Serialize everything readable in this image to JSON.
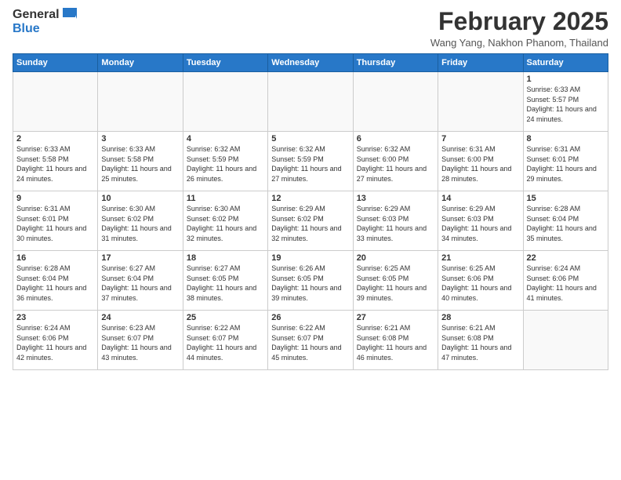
{
  "header": {
    "logo_general": "General",
    "logo_blue": "Blue",
    "month_title": "February 2025",
    "location": "Wang Yang, Nakhon Phanom, Thailand"
  },
  "weekdays": [
    "Sunday",
    "Monday",
    "Tuesday",
    "Wednesday",
    "Thursday",
    "Friday",
    "Saturday"
  ],
  "weeks": [
    [
      {
        "day": "",
        "info": ""
      },
      {
        "day": "",
        "info": ""
      },
      {
        "day": "",
        "info": ""
      },
      {
        "day": "",
        "info": ""
      },
      {
        "day": "",
        "info": ""
      },
      {
        "day": "",
        "info": ""
      },
      {
        "day": "1",
        "info": "Sunrise: 6:33 AM\nSunset: 5:57 PM\nDaylight: 11 hours and 24 minutes."
      }
    ],
    [
      {
        "day": "2",
        "info": "Sunrise: 6:33 AM\nSunset: 5:58 PM\nDaylight: 11 hours and 24 minutes."
      },
      {
        "day": "3",
        "info": "Sunrise: 6:33 AM\nSunset: 5:58 PM\nDaylight: 11 hours and 25 minutes."
      },
      {
        "day": "4",
        "info": "Sunrise: 6:32 AM\nSunset: 5:59 PM\nDaylight: 11 hours and 26 minutes."
      },
      {
        "day": "5",
        "info": "Sunrise: 6:32 AM\nSunset: 5:59 PM\nDaylight: 11 hours and 27 minutes."
      },
      {
        "day": "6",
        "info": "Sunrise: 6:32 AM\nSunset: 6:00 PM\nDaylight: 11 hours and 27 minutes."
      },
      {
        "day": "7",
        "info": "Sunrise: 6:31 AM\nSunset: 6:00 PM\nDaylight: 11 hours and 28 minutes."
      },
      {
        "day": "8",
        "info": "Sunrise: 6:31 AM\nSunset: 6:01 PM\nDaylight: 11 hours and 29 minutes."
      }
    ],
    [
      {
        "day": "9",
        "info": "Sunrise: 6:31 AM\nSunset: 6:01 PM\nDaylight: 11 hours and 30 minutes."
      },
      {
        "day": "10",
        "info": "Sunrise: 6:30 AM\nSunset: 6:02 PM\nDaylight: 11 hours and 31 minutes."
      },
      {
        "day": "11",
        "info": "Sunrise: 6:30 AM\nSunset: 6:02 PM\nDaylight: 11 hours and 32 minutes."
      },
      {
        "day": "12",
        "info": "Sunrise: 6:29 AM\nSunset: 6:02 PM\nDaylight: 11 hours and 32 minutes."
      },
      {
        "day": "13",
        "info": "Sunrise: 6:29 AM\nSunset: 6:03 PM\nDaylight: 11 hours and 33 minutes."
      },
      {
        "day": "14",
        "info": "Sunrise: 6:29 AM\nSunset: 6:03 PM\nDaylight: 11 hours and 34 minutes."
      },
      {
        "day": "15",
        "info": "Sunrise: 6:28 AM\nSunset: 6:04 PM\nDaylight: 11 hours and 35 minutes."
      }
    ],
    [
      {
        "day": "16",
        "info": "Sunrise: 6:28 AM\nSunset: 6:04 PM\nDaylight: 11 hours and 36 minutes."
      },
      {
        "day": "17",
        "info": "Sunrise: 6:27 AM\nSunset: 6:04 PM\nDaylight: 11 hours and 37 minutes."
      },
      {
        "day": "18",
        "info": "Sunrise: 6:27 AM\nSunset: 6:05 PM\nDaylight: 11 hours and 38 minutes."
      },
      {
        "day": "19",
        "info": "Sunrise: 6:26 AM\nSunset: 6:05 PM\nDaylight: 11 hours and 39 minutes."
      },
      {
        "day": "20",
        "info": "Sunrise: 6:25 AM\nSunset: 6:05 PM\nDaylight: 11 hours and 39 minutes."
      },
      {
        "day": "21",
        "info": "Sunrise: 6:25 AM\nSunset: 6:06 PM\nDaylight: 11 hours and 40 minutes."
      },
      {
        "day": "22",
        "info": "Sunrise: 6:24 AM\nSunset: 6:06 PM\nDaylight: 11 hours and 41 minutes."
      }
    ],
    [
      {
        "day": "23",
        "info": "Sunrise: 6:24 AM\nSunset: 6:06 PM\nDaylight: 11 hours and 42 minutes."
      },
      {
        "day": "24",
        "info": "Sunrise: 6:23 AM\nSunset: 6:07 PM\nDaylight: 11 hours and 43 minutes."
      },
      {
        "day": "25",
        "info": "Sunrise: 6:22 AM\nSunset: 6:07 PM\nDaylight: 11 hours and 44 minutes."
      },
      {
        "day": "26",
        "info": "Sunrise: 6:22 AM\nSunset: 6:07 PM\nDaylight: 11 hours and 45 minutes."
      },
      {
        "day": "27",
        "info": "Sunrise: 6:21 AM\nSunset: 6:08 PM\nDaylight: 11 hours and 46 minutes."
      },
      {
        "day": "28",
        "info": "Sunrise: 6:21 AM\nSunset: 6:08 PM\nDaylight: 11 hours and 47 minutes."
      },
      {
        "day": "",
        "info": ""
      }
    ]
  ]
}
